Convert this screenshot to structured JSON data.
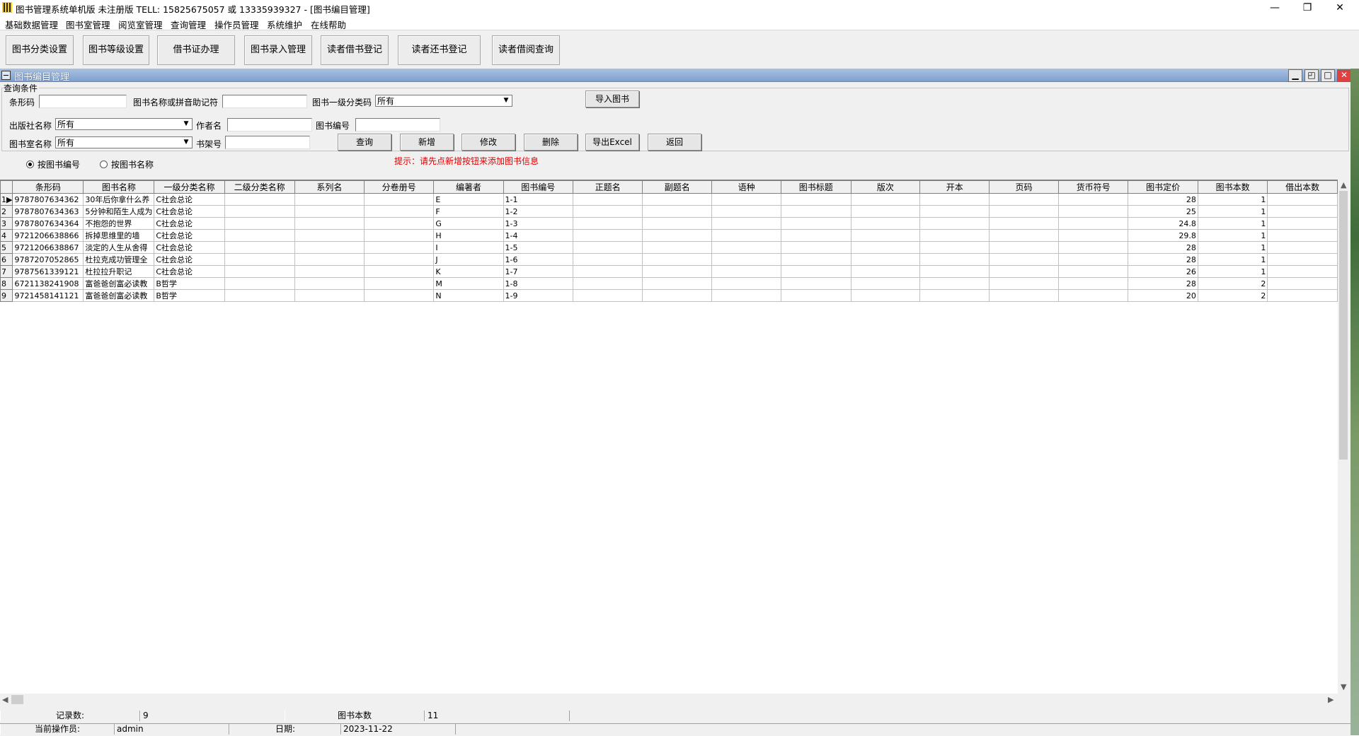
{
  "window": {
    "title": "图书管理系统单机版 未注册版 TELL: 15825675057 或 13335939327 - [图书编目管理]",
    "min_glyph": "—",
    "restore_glyph": "❐",
    "close_glyph": "✕"
  },
  "menu": [
    "基础数据管理",
    "图书室管理",
    "阅览室管理",
    "查询管理",
    "操作员管理",
    "系统维护",
    "在线帮助"
  ],
  "toolbar": [
    "图书分类设置",
    "图书等级设置",
    "借书证办理",
    "图书录入管理",
    "读者借书登记",
    "读者还书登记",
    "读者借阅查询"
  ],
  "child": {
    "title": "图书编目管理",
    "min_glyph": "▁",
    "restore_glyph": "◰",
    "max_glyph": "□",
    "close_glyph": "✕"
  },
  "query": {
    "group_label": "查询条件",
    "barcode_label": "条形码",
    "barcode_value": "",
    "bookname_label": "图书名称或拼音助记符",
    "bookname_value": "",
    "category_label": "图书一级分类码",
    "category_value": "所有",
    "publisher_label": "出版社名称",
    "publisher_value": "所有",
    "author_label": "作者名",
    "author_value": "",
    "bookno_label": "图书编号",
    "bookno_value": "",
    "room_label": "图书室名称",
    "room_value": "所有",
    "shelf_label": "书架号",
    "shelf_value": "",
    "radio_by_no": "按图书编号",
    "radio_by_name": "按图书名称",
    "selected_radio": "按图书编号"
  },
  "buttons": {
    "import": "导入图书",
    "query": "查询",
    "add": "新增",
    "edit": "修改",
    "delete": "删除",
    "export": "导出Excel",
    "back": "返回"
  },
  "hint": "提示：请先点新增按钮来添加图书信息",
  "grid": {
    "columns": [
      "条形码",
      "图书名称",
      "一级分类名称",
      "二级分类名称",
      "系列名",
      "分卷册号",
      "编著者",
      "图书编号",
      "正题名",
      "副题名",
      "语种",
      "图书标题",
      "版次",
      "开本",
      "页码",
      "货币符号",
      "图书定价",
      "图书本数",
      "借出本数"
    ],
    "rows": [
      {
        "n": "1",
        "barcode": "9787807634362",
        "name": "30年后你拿什么养",
        "cat1": "C社会总论",
        "author": "E",
        "no": "1-1",
        "price": "28",
        "count": "1"
      },
      {
        "n": "2",
        "barcode": "9787807634363",
        "name": "5分钟和陌生人成为",
        "cat1": "C社会总论",
        "author": "F",
        "no": "1-2",
        "price": "25",
        "count": "1"
      },
      {
        "n": "3",
        "barcode": "9787807634364",
        "name": "不抱怨的世界",
        "cat1": "C社会总论",
        "author": "G",
        "no": "1-3",
        "price": "24.8",
        "count": "1"
      },
      {
        "n": "4",
        "barcode": "9721206638866",
        "name": "拆掉思维里的墙",
        "cat1": "C社会总论",
        "author": "H",
        "no": "1-4",
        "price": "29.8",
        "count": "1"
      },
      {
        "n": "5",
        "barcode": "9721206638867",
        "name": "淡定的人生从舍得",
        "cat1": "C社会总论",
        "author": "I",
        "no": "1-5",
        "price": "28",
        "count": "1"
      },
      {
        "n": "6",
        "barcode": "9787207052865",
        "name": "杜拉克成功管理全",
        "cat1": "C社会总论",
        "author": "J",
        "no": "1-6",
        "price": "28",
        "count": "1"
      },
      {
        "n": "7",
        "barcode": "9787561339121",
        "name": "杜拉拉升职记",
        "cat1": "C社会总论",
        "author": "K",
        "no": "1-7",
        "price": "26",
        "count": "1"
      },
      {
        "n": "8",
        "barcode": "6721138241908",
        "name": "富爸爸创富必读教",
        "cat1": "B哲学",
        "author": "M",
        "no": "1-8",
        "price": "28",
        "count": "2"
      },
      {
        "n": "9",
        "barcode": "9721458141121",
        "name": "富爸爸创富必读教",
        "cat1": "B哲学",
        "author": "N",
        "no": "1-9",
        "price": "20",
        "count": "2"
      }
    ]
  },
  "status": {
    "records_label": "记录数:",
    "records_value": "9",
    "books_label": "图书本数",
    "books_value": "11",
    "operator_label": "当前操作员:",
    "operator_value": "admin",
    "date_label": "日期:",
    "date_value": "2023-11-22"
  }
}
